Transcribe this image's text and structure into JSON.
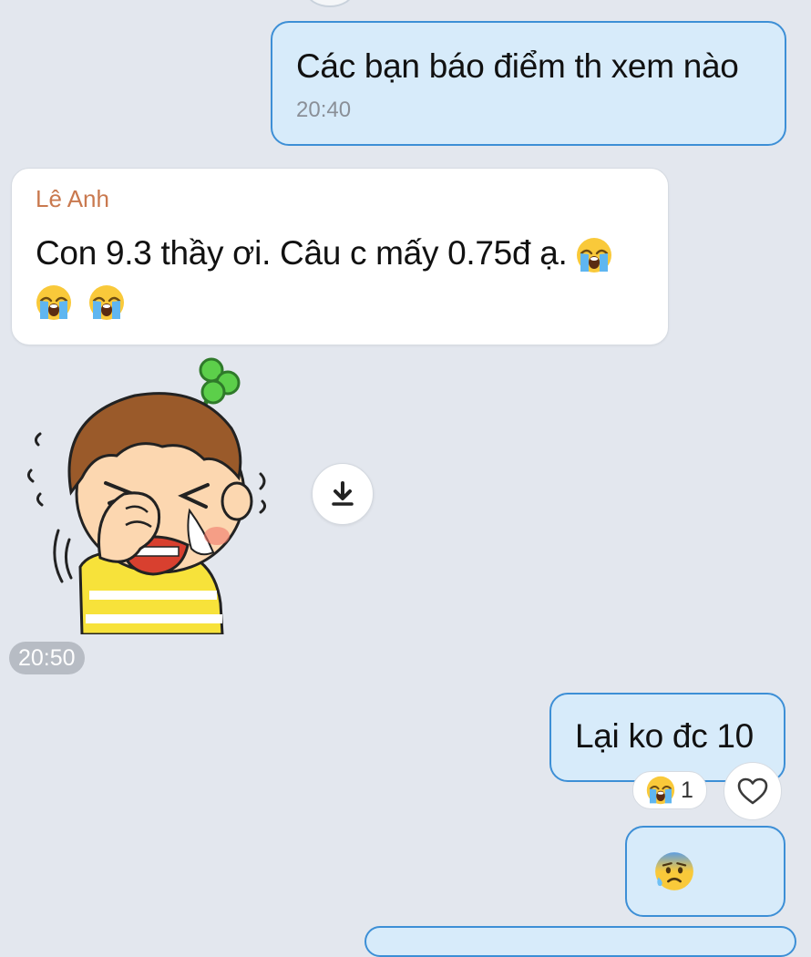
{
  "messages": {
    "m1": {
      "text": "Các bạn báo điểm th xem nào",
      "time": "20:40"
    },
    "m2": {
      "sender": "Lê Anh",
      "text": "Con 9.3 thầy ơi. Câu c mấy 0.75đ ạ."
    },
    "sticker": {
      "time": "20:50",
      "icon": "crying-boy-sticker",
      "download_icon": "download-icon"
    },
    "m3": {
      "text": "Lại ko đc 10",
      "reaction_count": "1",
      "reaction_icon": "loudly-crying-face-emoji",
      "like_icon": "heart-icon"
    },
    "m4": {
      "icon": "anxious-face-with-sweat-emoji"
    }
  },
  "colors": {
    "background": "#e3e7ee",
    "sent_bubble": "#d7ebfa",
    "sent_border": "#3d8fd6",
    "sender_name": "#c9794f"
  }
}
